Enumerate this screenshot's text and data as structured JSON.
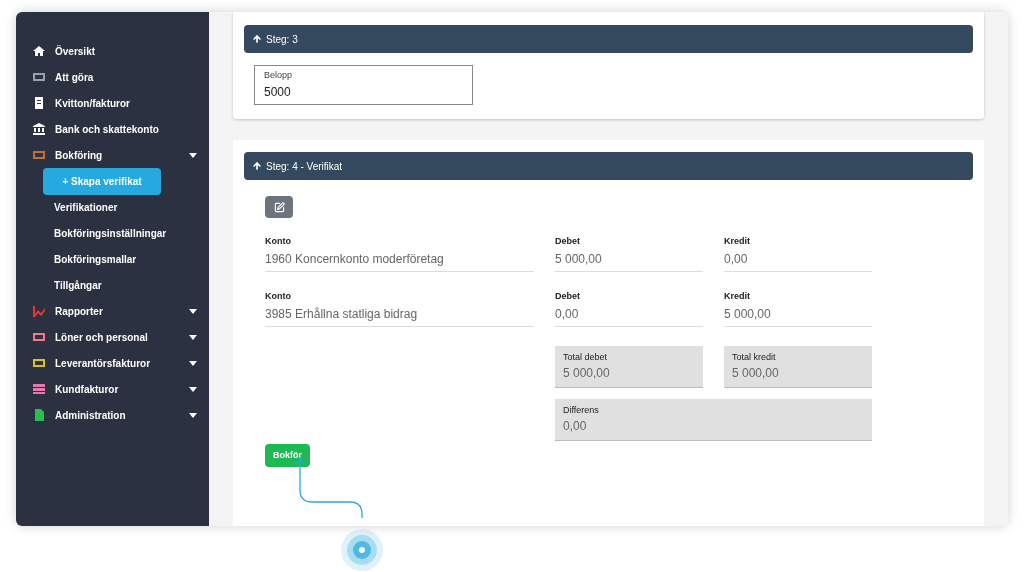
{
  "sidebar": {
    "items": [
      {
        "label": "Översikt",
        "color": "#ffffff",
        "expandable": false
      },
      {
        "label": "Att göra",
        "color": "#9aa0ac",
        "expandable": false
      },
      {
        "label": "Kvitton/fakturor",
        "color": "#ffffff",
        "expandable": false
      },
      {
        "label": "Bank och skattekonto",
        "color": "#ffffff",
        "expandable": false
      },
      {
        "label": "Bokföring",
        "color": "#b8733a",
        "expandable": true,
        "children": [
          {
            "label": "+ Skapa verifikat",
            "selected": true
          },
          {
            "label": "Verifikationer",
            "selected": false
          },
          {
            "label": "Bokföringsinställningar",
            "selected": false
          },
          {
            "label": "Bokföringsmallar",
            "selected": false
          },
          {
            "label": "Tillgångar",
            "selected": false
          }
        ]
      },
      {
        "label": "Rapporter",
        "color": "#e53935",
        "expandable": true
      },
      {
        "label": "Löner och personal",
        "color": "#ef7b8a",
        "expandable": true
      },
      {
        "label": "Leverantörsfakturor",
        "color": "#d9c21a",
        "expandable": true
      },
      {
        "label": "Kundfakturor",
        "color": "#e07ab0",
        "expandable": true
      },
      {
        "label": "Administration",
        "color": "#27c04a",
        "expandable": true
      }
    ]
  },
  "step3": {
    "title": "Steg: 3",
    "field": {
      "label": "Belopp",
      "value": "5000"
    }
  },
  "step4": {
    "title": "Steg: 4 - Verifikat",
    "rows": [
      {
        "account_label": "Konto",
        "account": "1960 Koncernkonto moderföretag",
        "debit_label": "Debet",
        "debit": "5 000,00",
        "credit_label": "Kredit",
        "credit": "0,00"
      },
      {
        "account_label": "Konto",
        "account": "3985 Erhållna statliga bidrag",
        "debit_label": "Debet",
        "debit": "0,00",
        "credit_label": "Kredit",
        "credit": "5 000,00"
      }
    ],
    "total_debit": {
      "label": "Total debet",
      "value": "5 000,00"
    },
    "total_credit": {
      "label": "Total kredit",
      "value": "5 000,00"
    },
    "difference": {
      "label": "Differens",
      "value": "0,00"
    },
    "submit": "Bokför"
  }
}
